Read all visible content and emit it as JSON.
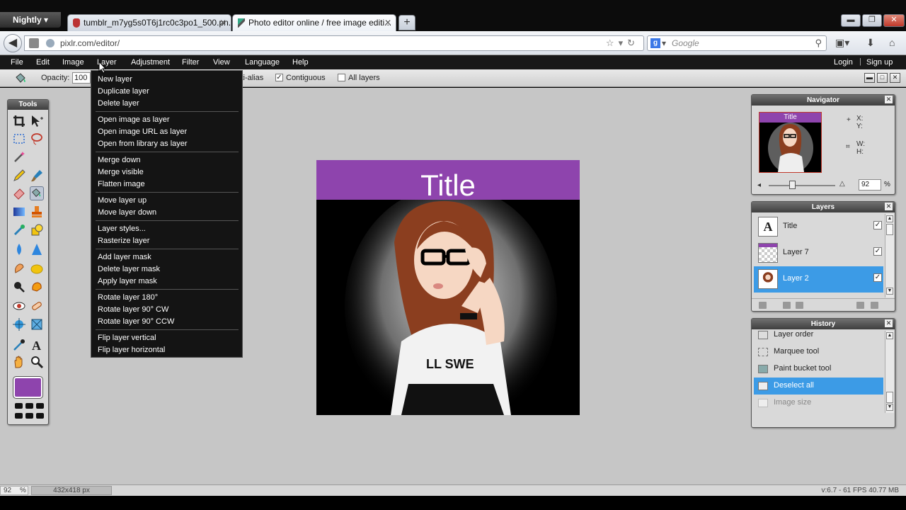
{
  "browser": {
    "app_button": "Nightly",
    "tabs": [
      {
        "label": "tumblr_m7yg5s0T6j1rc0c3po1_500.pn...",
        "active": false
      },
      {
        "label": "Photo editor online / free image editi...",
        "active": true
      }
    ],
    "url": "pixlr.com/editor/",
    "search_engine_letter": "g",
    "search_placeholder": "Google"
  },
  "menubar": {
    "items": [
      "File",
      "Edit",
      "Image",
      "Layer",
      "Adjustment",
      "Filter",
      "View",
      "Language",
      "Help"
    ],
    "active": "Layer",
    "login": "Login",
    "separator": "|",
    "signup": "Sign up"
  },
  "options": {
    "opacity_label": "Opacity:",
    "opacity_value": "100",
    "antialias_label": "Anti-alias",
    "antialias_checked": true,
    "contiguous_label": "Contiguous",
    "contiguous_checked": true,
    "alllayers_label": "All layers",
    "alllayers_checked": false
  },
  "layer_menu": {
    "groups": [
      [
        "New layer",
        "Duplicate layer",
        "Delete layer"
      ],
      [
        "Open image as layer",
        "Open image URL as layer",
        "Open from library as layer"
      ],
      [
        "Merge down",
        "Merge visible",
        "Flatten image"
      ],
      [
        "Move layer up",
        "Move layer down"
      ],
      [
        "Layer styles...",
        "Rasterize layer"
      ],
      [
        "Add layer mask",
        "Delete layer mask",
        "Apply layer mask"
      ],
      [
        "Rotate layer 180°",
        "Rotate layer 90° CW",
        "Rotate layer 90° CCW"
      ],
      [
        "Flip layer vertical",
        "Flip layer horizontal"
      ]
    ]
  },
  "tools": {
    "title": "Tools",
    "foreground_color": "#8e44ad"
  },
  "canvas": {
    "title_text": "Title",
    "header_color": "#8e44ad"
  },
  "navigator": {
    "title": "Navigator",
    "thumb_title": "Title",
    "x_label": "X:",
    "y_label": "Y:",
    "w_label": "W:",
    "h_label": "H:",
    "zoom": "92",
    "zoom_unit": "%",
    "zoom_level_fraction": 0.35
  },
  "layers": {
    "title": "Layers",
    "items": [
      {
        "name": "Title",
        "visible": true,
        "selected": false,
        "thumb": "text"
      },
      {
        "name": "Layer 7",
        "visible": true,
        "selected": false,
        "thumb": "transparent"
      },
      {
        "name": "Layer 2",
        "visible": true,
        "selected": true,
        "thumb": "photo"
      }
    ]
  },
  "history": {
    "title": "History",
    "items": [
      {
        "label": "Layer order",
        "state": "normal"
      },
      {
        "label": "Marquee tool",
        "state": "normal"
      },
      {
        "label": "Paint bucket tool",
        "state": "normal"
      },
      {
        "label": "Deselect all",
        "state": "selected"
      },
      {
        "label": "Image size",
        "state": "dim"
      }
    ]
  },
  "status": {
    "zoom": "92",
    "zoom_unit": "%",
    "dimensions": "432x418 px",
    "fps": "v:6.7 - 61 FPS 40.77 MB"
  },
  "colors": {
    "accent_purple": "#8e44ad",
    "selection_blue": "#3c9be6",
    "menubar_bg": "#181818",
    "workspace_bg": "#c6c6c6"
  }
}
